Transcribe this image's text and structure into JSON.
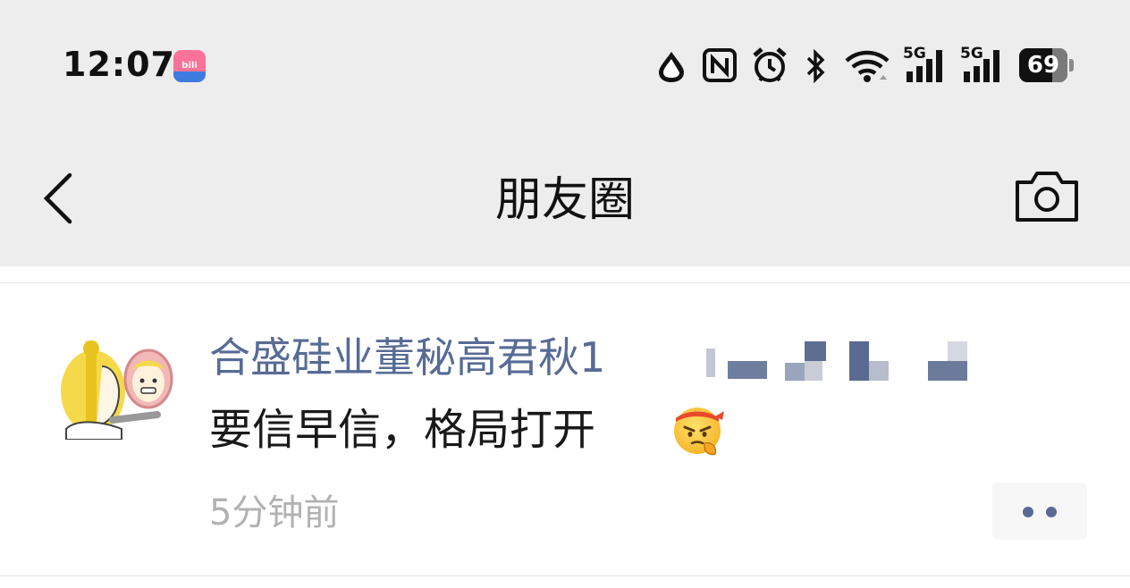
{
  "status_bar": {
    "time": "12:07",
    "app_badge_icon": "bilibili-icon",
    "icons": [
      "water-drop-icon",
      "nfc-icon",
      "alarm-icon",
      "bluetooth-icon",
      "wifi-icon",
      "signal-5g-icon",
      "signal-5g-icon"
    ],
    "network_label_1": "5G",
    "network_label_2": "5G",
    "battery_level": "69"
  },
  "nav": {
    "title": "朋友圈",
    "back_icon": "chevron-left-icon",
    "camera_icon": "camera-icon"
  },
  "post": {
    "author": "合盛硅业董秘高君秋1",
    "text": "要信早信，格局打开",
    "emoji_icon": "determined-face-emoji",
    "time": "5分钟前",
    "more_icon": "more-dots-icon"
  },
  "colors": {
    "topbar_bg": "#ededed",
    "name_blue": "#576b95",
    "time_gray": "#b2b2b2"
  }
}
